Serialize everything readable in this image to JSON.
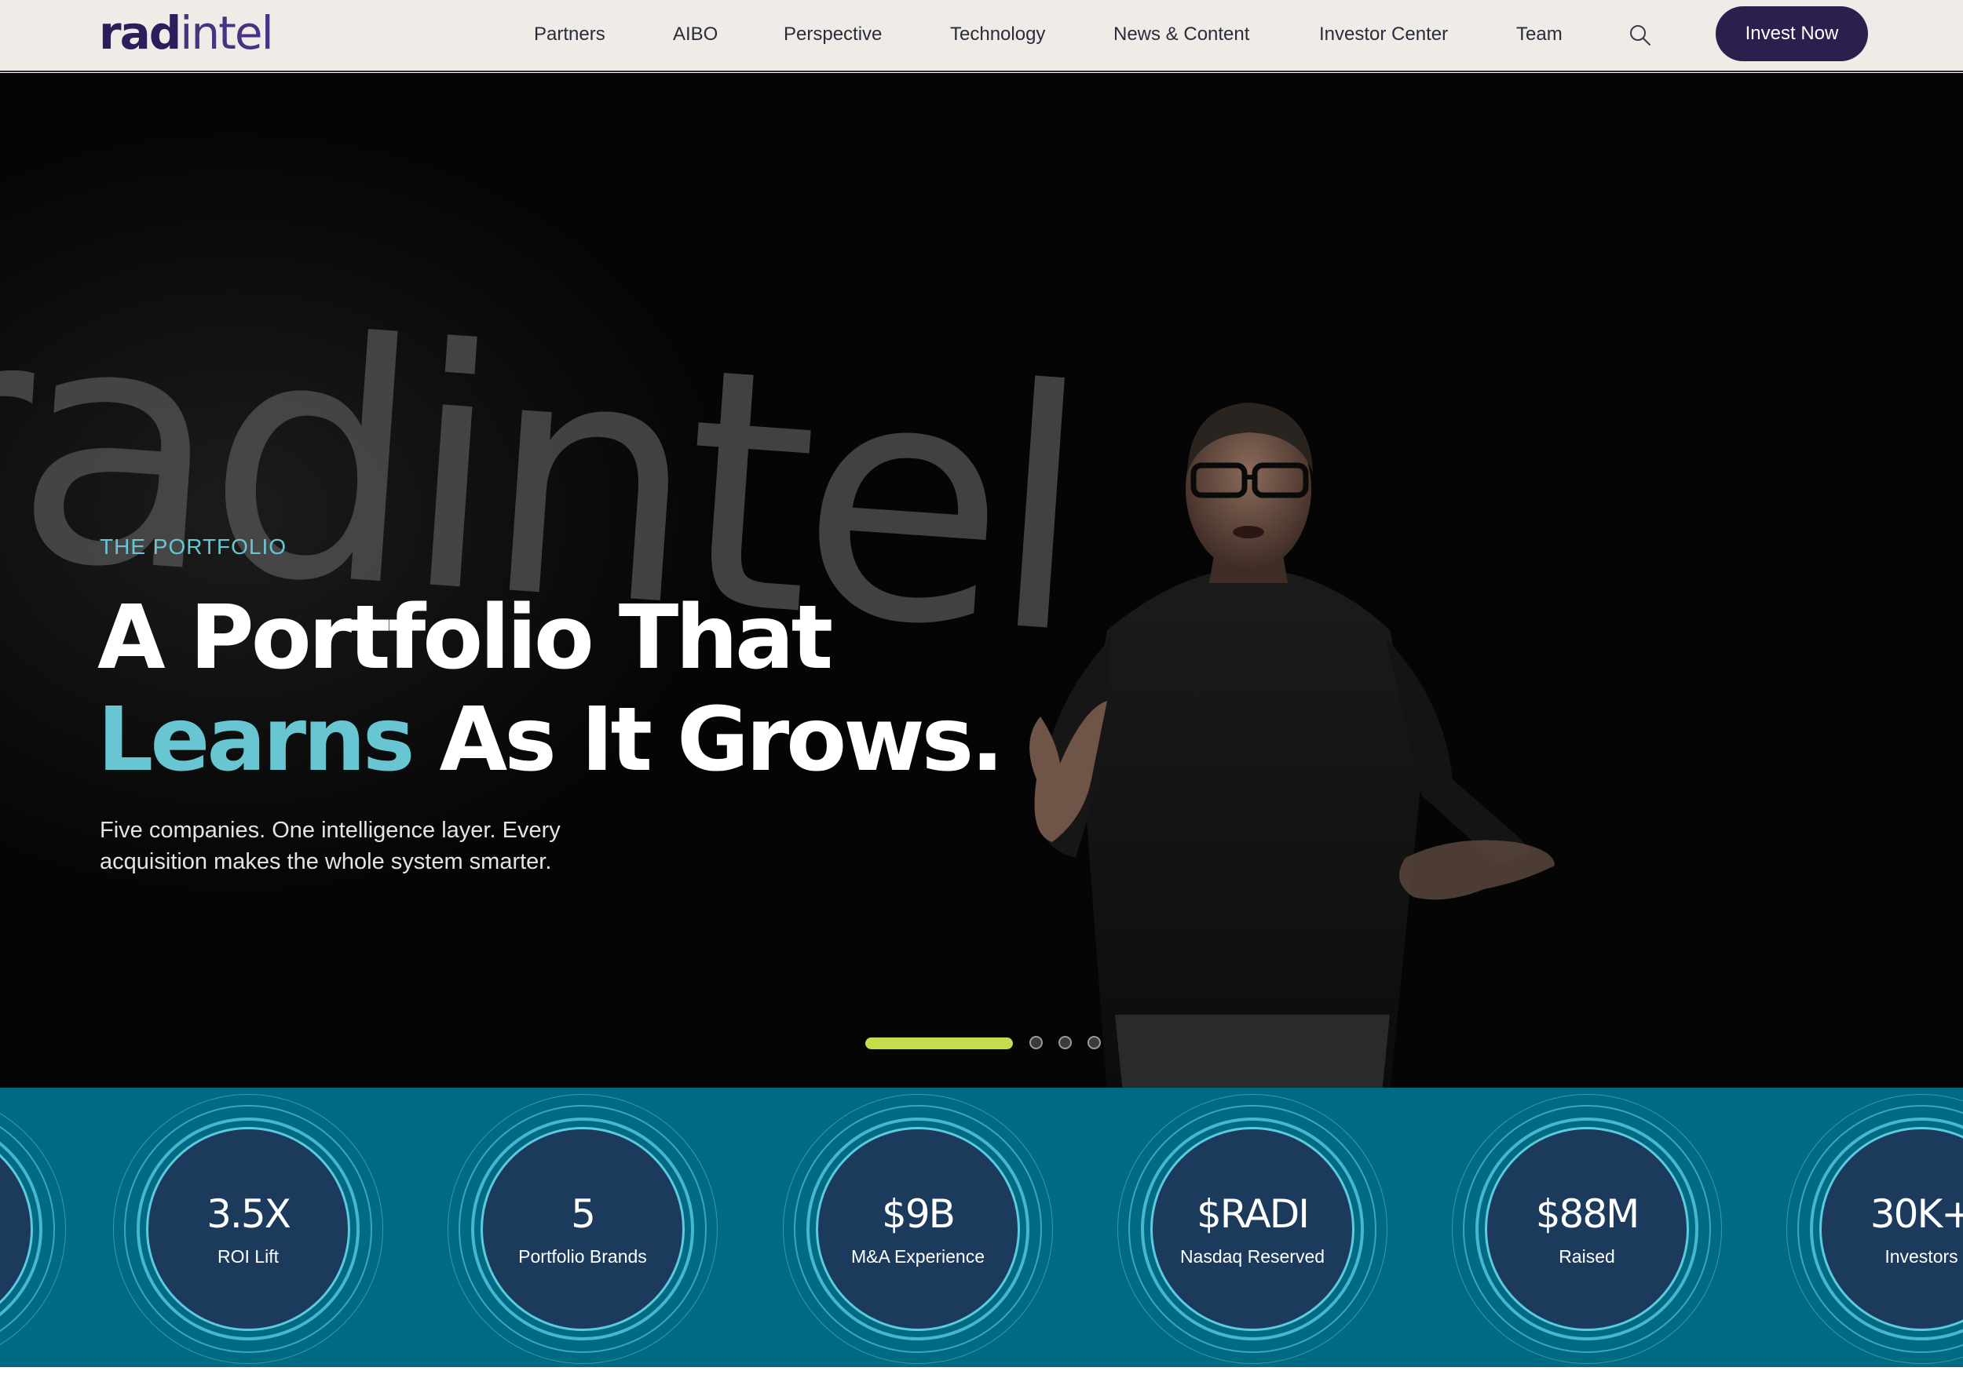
{
  "brand": {
    "logo_rad": "rad",
    "logo_intel": "intel"
  },
  "nav": {
    "items": [
      {
        "label": "Partners"
      },
      {
        "label": "AIBO"
      },
      {
        "label": "Perspective"
      },
      {
        "label": "Technology"
      },
      {
        "label": "News & Content"
      },
      {
        "label": "Investor Center"
      },
      {
        "label": "Team"
      }
    ],
    "cta_label": "Invest Now"
  },
  "hero": {
    "eyebrow": "THE PORTFOLIO",
    "headline_line1": "A Portfolio That",
    "headline_accent": "Learns",
    "headline_line2_rest": " As It Grows.",
    "subtext": "Five companies. One intelligence layer. Every acquisition makes the whole system smarter.",
    "background_wordmark": "radintel",
    "carousel": {
      "slide_count": 4,
      "active_slide": 1
    }
  },
  "stats": [
    {
      "value": "",
      "label": ""
    },
    {
      "value": "3.5X",
      "label": "ROI Lift"
    },
    {
      "value": "5",
      "label": "Portfolio Brands"
    },
    {
      "value": "$9B",
      "label": "M&A Experience"
    },
    {
      "value": "$RADI",
      "label": "Nasdaq Reserved"
    },
    {
      "value": "$88M",
      "label": "Raised"
    },
    {
      "value": "30K+",
      "label": "Investors"
    }
  ],
  "colors": {
    "nav_bg": "#efebe6",
    "brand_purple": "#2b1f4e",
    "accent_cyan": "#68c6d3",
    "carousel_active": "#c7dc4c",
    "stats_bg": "#006a84",
    "stat_core": "#1b3a5c"
  },
  "icons": {
    "search": "search-icon"
  }
}
